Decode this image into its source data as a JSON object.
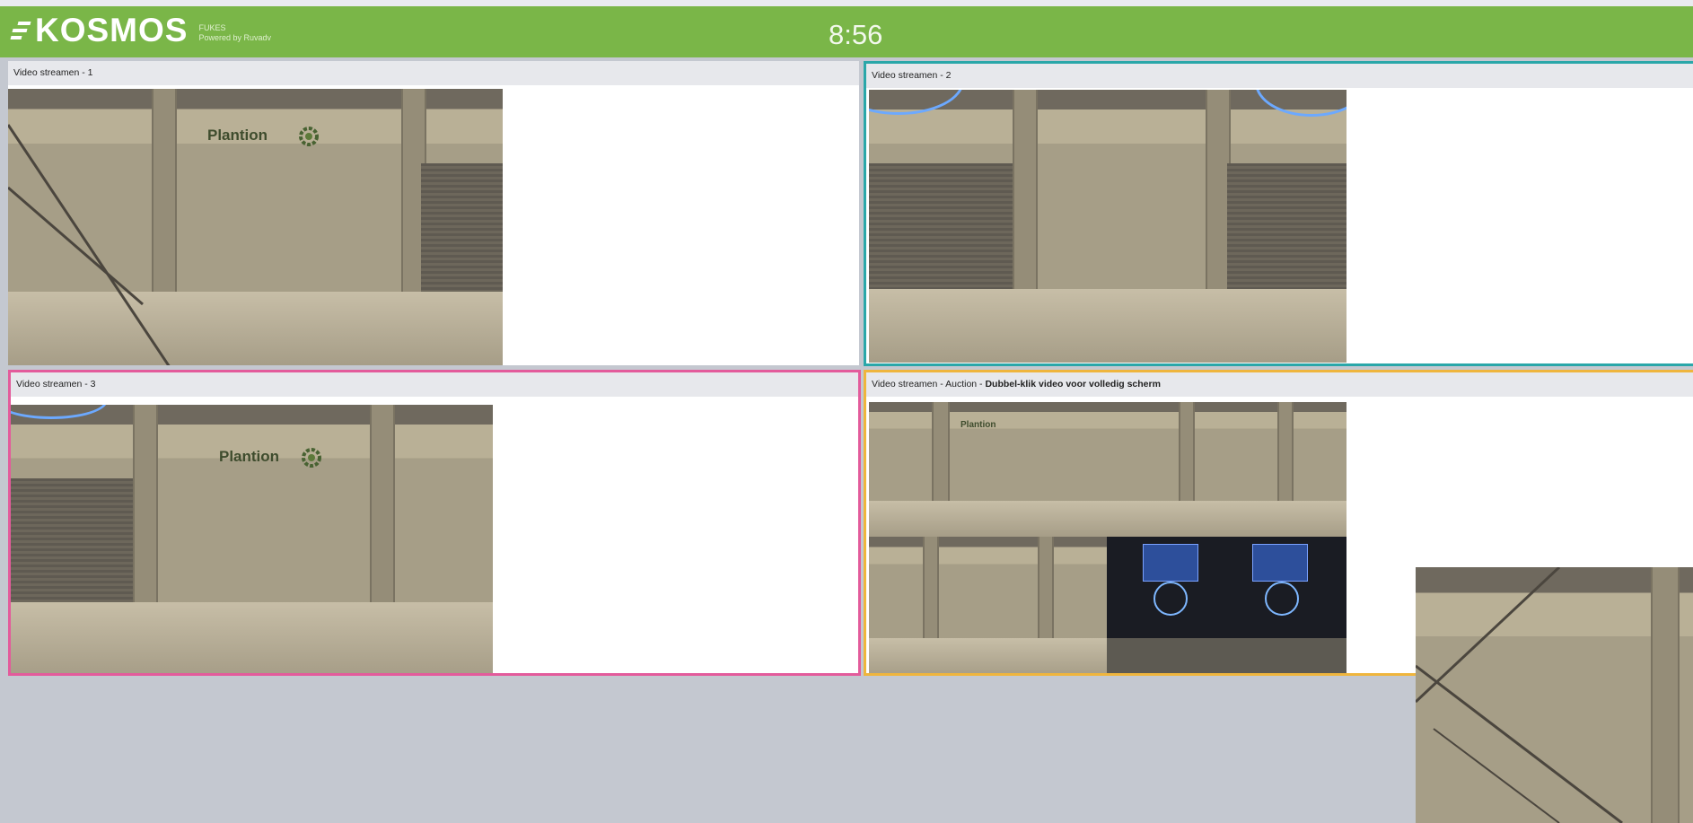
{
  "header": {
    "brand": "KOSMOS",
    "sub_line_1": "FUKES",
    "sub_line_2": "Powered by Ruvadv",
    "clock": "8:56",
    "accent_color": "#7ab648"
  },
  "panels": [
    {
      "title": "Video streamen - 1",
      "border_color": "none",
      "sign_text": "Plantion"
    },
    {
      "title": "Video streamen - 2",
      "border_color": "#2aa7a9",
      "sign_text": ""
    },
    {
      "title": "Video streamen - 3",
      "border_color": "#e35b9b",
      "sign_text": "Plantion"
    },
    {
      "title_prefix": "Video streamen - Auction - ",
      "title_bold": "Dubbel-klik video voor volledig scherm",
      "border_color": "#efb53d",
      "sign_text": "Plantion"
    }
  ],
  "icons": {
    "brand_logo": "kosmos-logo-icon",
    "gear": "gear-icon"
  }
}
